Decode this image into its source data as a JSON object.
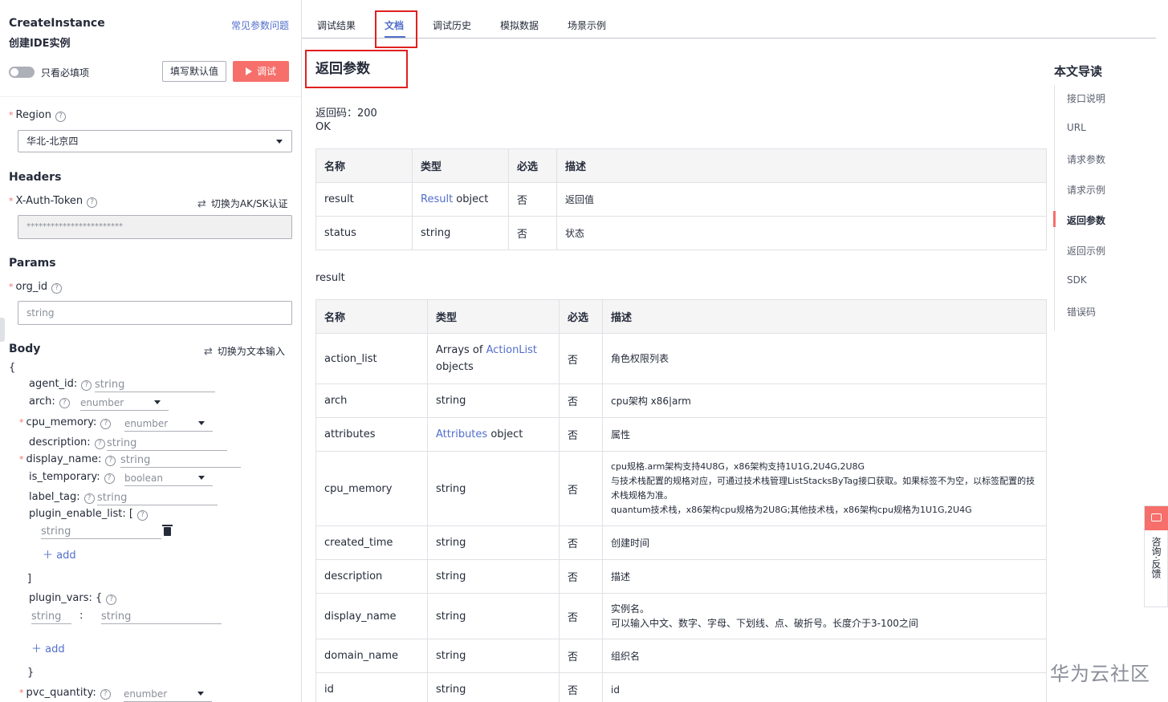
{
  "left": {
    "api_name": "CreateInstance",
    "api_title": "创建IDE实例",
    "faq_link": "常见参数问题",
    "toggle_label": "只看必填项",
    "fill_default_button": "填写默认值",
    "debug_button": "调试",
    "region_label": "Region",
    "region_value": "华北-北京四",
    "headers_title": "Headers",
    "auth_token_label": "X-Auth-Token",
    "switch_aksk": "切换为AK/SK认证",
    "auth_token_value": "************************",
    "params_title": "Params",
    "org_id_label": "org_id",
    "org_id_placeholder": "string",
    "body_title": "Body",
    "switch_text_input": "切换为文本输入",
    "open_brace": "{",
    "close_brace": "}",
    "close_bracket": "]",
    "body_fields": {
      "agent_id": {
        "label": "agent_id:",
        "placeholder": "string"
      },
      "arch": {
        "label": "arch:",
        "placeholder": "enumber"
      },
      "cpu_memory": {
        "label": "cpu_memory:",
        "placeholder": "enumber"
      },
      "description": {
        "label": "description:",
        "placeholder": "string"
      },
      "display_name": {
        "label": "display_name:",
        "placeholder": "string"
      },
      "is_temporary": {
        "label": "is_temporary:",
        "placeholder": "boolean"
      },
      "label_tag": {
        "label": "label_tag:",
        "placeholder": "string"
      },
      "plugin_enable_list": {
        "label": "plugin_enable_list: [",
        "placeholder": "string"
      },
      "plugin_vars": {
        "label": "plugin_vars: {",
        "key_placeholder": "string",
        "separator": ":",
        "value_placeholder": "string"
      },
      "pvc_quantity": {
        "label": "pvc_quantity:",
        "placeholder": "enumber"
      }
    },
    "add_label": "add"
  },
  "tabs": [
    {
      "label": "调试结果"
    },
    {
      "label": "文档"
    },
    {
      "label": "调试历史"
    },
    {
      "label": "模拟数据"
    },
    {
      "label": "场景示例"
    }
  ],
  "doc": {
    "heading": "返回参数",
    "return_code": "返回码：200",
    "return_status": "OK",
    "headers": [
      "名称",
      "类型",
      "必选",
      "描述"
    ],
    "table1": [
      {
        "name": "result",
        "type_link": "Result",
        "type_rest": " object",
        "required": "否",
        "desc": "返回值"
      },
      {
        "name": "status",
        "type_link": "",
        "type_rest": "string",
        "required": "否",
        "desc": "状态"
      }
    ],
    "sub_label": "result",
    "table2": [
      {
        "name": "action_list",
        "type_pre": "Arrays of ",
        "type_link": "ActionList",
        "type_rest": " objects",
        "required": "否",
        "desc": "角色权限列表"
      },
      {
        "name": "arch",
        "type_pre": "",
        "type_link": "",
        "type_rest": "string",
        "required": "否",
        "desc": "cpu架构 x86|arm"
      },
      {
        "name": "attributes",
        "type_pre": "",
        "type_link": "Attributes",
        "type_rest": " object",
        "required": "否",
        "desc": "属性"
      },
      {
        "name": "cpu_memory",
        "type_pre": "",
        "type_link": "",
        "type_rest": "string",
        "required": "否",
        "desc_lines": [
          "cpu规格.arm架构支持4U8G，x86架构支持1U1G,2U4G,2U8G",
          "与技术栈配置的规格对应，可通过技术栈管理ListStacksByTag接口获取。如果标签不为空，以标签配置的技术栈规格为准。",
          "quantum技术栈，x86架构cpu规格为2U8G;其他技术栈，x86架构cpu规格为1U1G,2U4G"
        ]
      },
      {
        "name": "created_time",
        "type_pre": "",
        "type_link": "",
        "type_rest": "string",
        "required": "否",
        "desc": "创建时间"
      },
      {
        "name": "description",
        "type_pre": "",
        "type_link": "",
        "type_rest": "string",
        "required": "否",
        "desc": "描述"
      },
      {
        "name": "display_name",
        "type_pre": "",
        "type_link": "",
        "type_rest": "string",
        "required": "否",
        "desc_lines": [
          "实例名。",
          "可以输入中文、数字、字母、下划线、点、破折号。长度介于3-100之间"
        ]
      },
      {
        "name": "domain_name",
        "type_pre": "",
        "type_link": "",
        "type_rest": "string",
        "required": "否",
        "desc": "组织名"
      },
      {
        "name": "id",
        "type_pre": "",
        "type_link": "",
        "type_rest": "string",
        "required": "否",
        "desc": "id"
      }
    ]
  },
  "toc": {
    "title": "本文导读",
    "items": [
      "接口说明",
      "URL",
      "请求参数",
      "请求示例",
      "返回参数",
      "返回示例",
      "SDK",
      "错误码"
    ],
    "active": "返回参数"
  },
  "feedback": {
    "label": "咨询·反馈"
  },
  "watermark": "华为云社区",
  "colors": {
    "accent": "#526ecc",
    "danger": "#f66f6a",
    "highlight_box": "#e02020"
  }
}
